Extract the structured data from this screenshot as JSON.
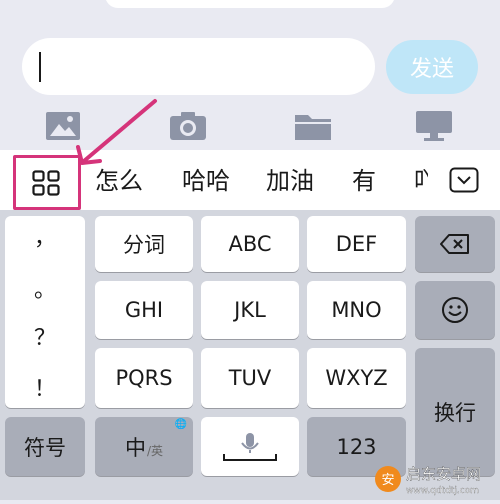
{
  "chat": {
    "send_label": "发送"
  },
  "candidates": [
    "怎么",
    "哈哈",
    "加油",
    "有",
    "吖"
  ],
  "keys": {
    "fenci": "分词",
    "abc": "ABC",
    "def": "DEF",
    "ghi": "GHI",
    "jkl": "JKL",
    "mno": "MNO",
    "pqrs": "PQRS",
    "tuv": "TUV",
    "wxyz": "WXYZ",
    "symbols": "符号",
    "zh": "中",
    "zh_sub": "/英",
    "num": "123",
    "newline": "换行"
  },
  "punctuation": [
    "，",
    "。",
    "？",
    "！"
  ],
  "watermark": {
    "title": "启东安卓网",
    "url": "www.qdtdtj.com"
  },
  "colors": {
    "highlight": "#d5347a",
    "send_button": "#bfe6f8",
    "icon_gray": "#8d94a6"
  }
}
